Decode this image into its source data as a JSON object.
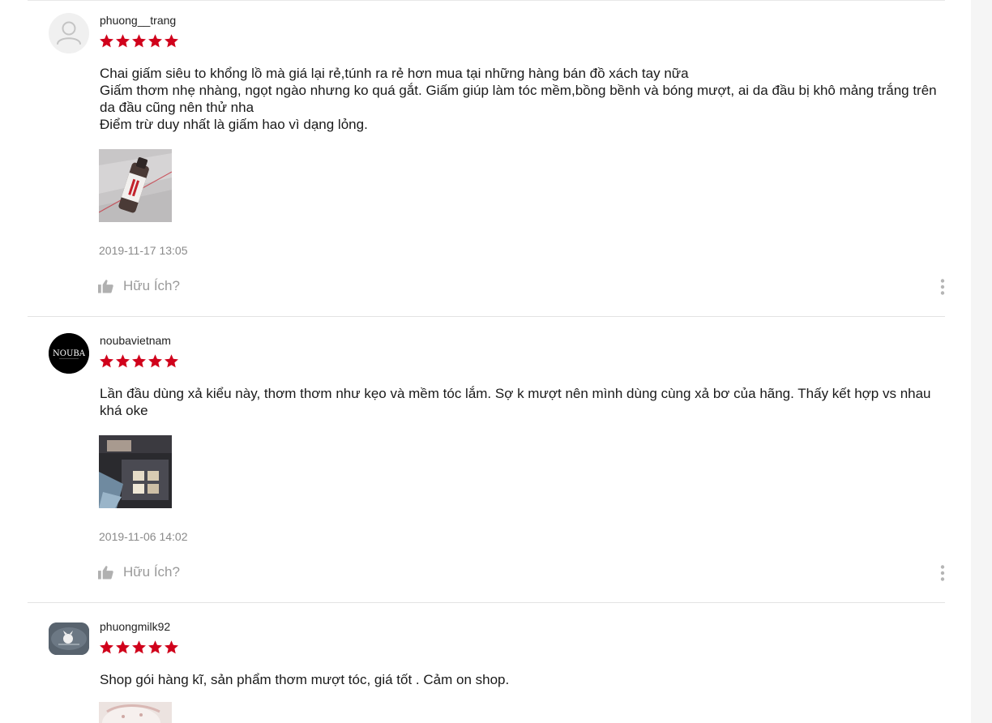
{
  "reviews": [
    {
      "username": "phuong__trang",
      "rating": 5,
      "comment": "Chai giấm siêu to khổng lồ mà giá lại rẻ,túnh ra rẻ hơn mua tại những hàng bán đồ xách tay nữa\nGiấm thơm nhẹ nhàng, ngọt ngào nhưng ko quá gắt. Giấm giúp làm tóc mềm,bồng bềnh và bóng mượt, ai da đầu bị khô mảng trắng trên da đầu cũng nên thử nha\nĐiểm trừ duy nhất là giấm hao vì dạng lỏng.",
      "timestamp": "2019-11-17 13:05",
      "helpful_label": "Hữu Ích?",
      "avatar_icon": "default-user-icon"
    },
    {
      "username": "noubavietnam",
      "rating": 5,
      "comment": "Lần đầu dùng xả kiểu này, thơm thơm như kẹo và mềm tóc lắm. Sợ k mượt nên mình dùng cùng xả bơ của hãng. Thấy kết hợp vs nhau khá oke",
      "timestamp": "2019-11-06 14:02",
      "helpful_label": "Hữu Ích?",
      "avatar_logo": "NOUBA"
    },
    {
      "username": "phuongmilk92",
      "rating": 5,
      "comment": "Shop gói hàng kĩ, sản phẩm thơm mượt tóc, giá tốt . Cảm on shop."
    }
  ],
  "colors": {
    "star": "#d0011b",
    "text": "#1a1a1a",
    "muted": "#8a8a8a",
    "divider": "#e3e3e3"
  }
}
